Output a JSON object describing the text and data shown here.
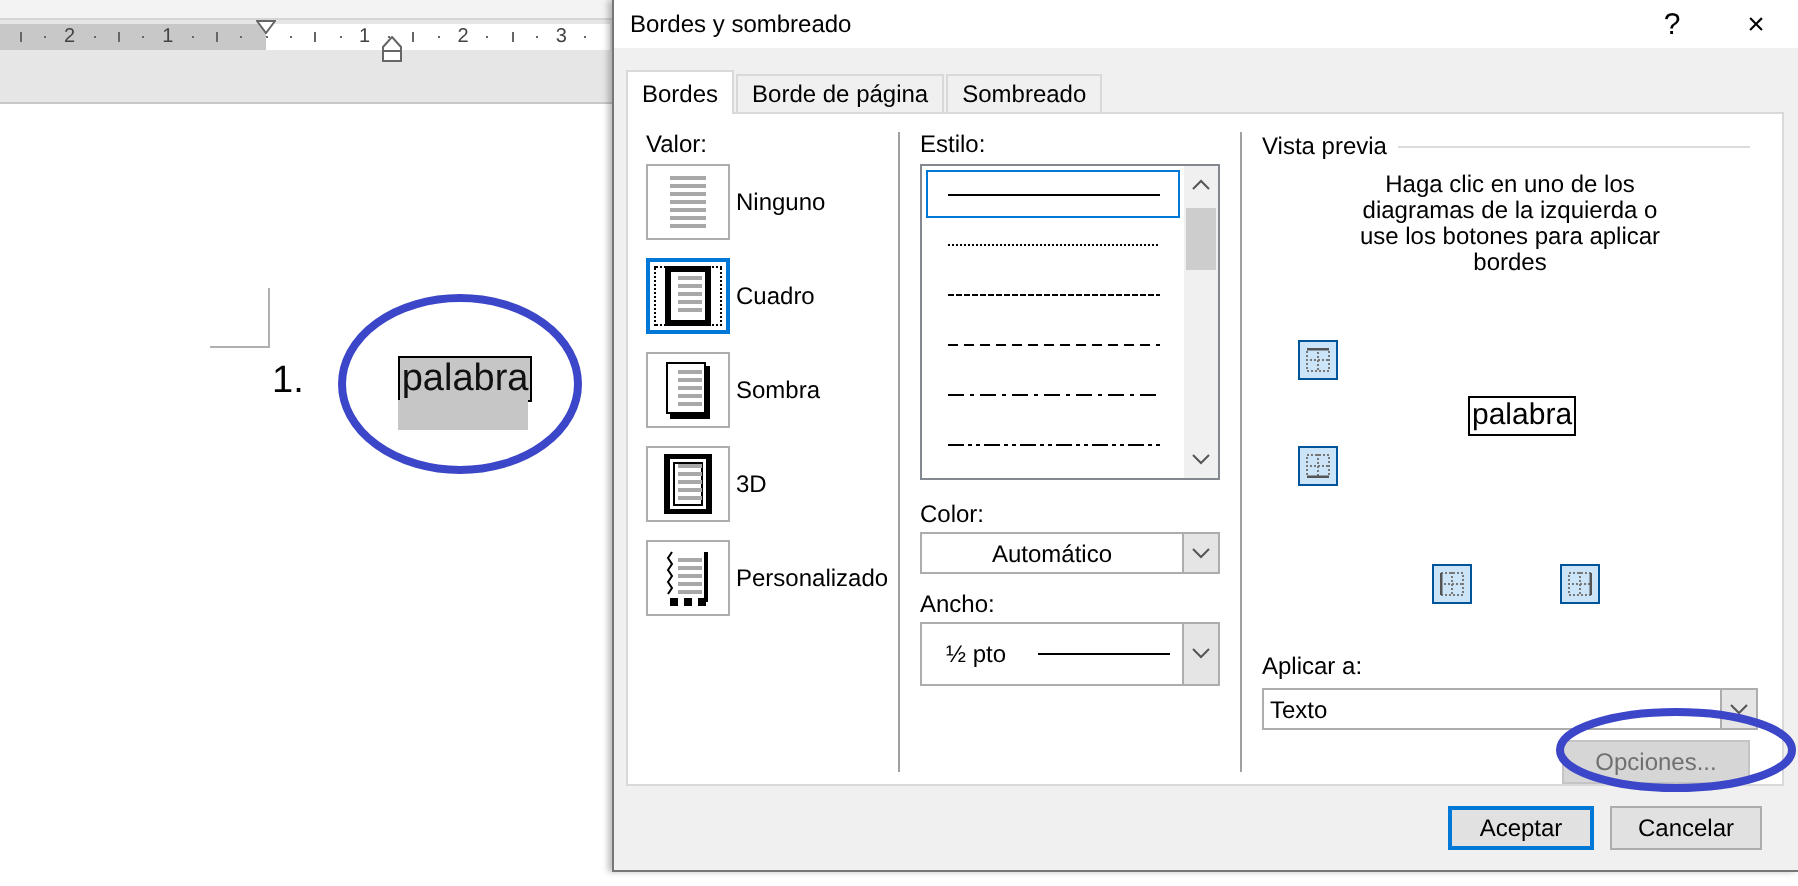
{
  "document": {
    "ruler_numbers": [
      "2",
      "1",
      "1",
      "2",
      "3"
    ],
    "list_number": "1.",
    "word": "palabra"
  },
  "dialog": {
    "title": "Bordes y sombreado",
    "help_button": "?",
    "close_button": "×",
    "tabs": [
      {
        "label": "Bordes",
        "selected": true
      },
      {
        "label": "Borde de página",
        "selected": false
      },
      {
        "label": "Sombreado",
        "selected": false
      }
    ],
    "setting": {
      "label": "Valor:",
      "items": [
        {
          "label": "Ninguno",
          "kind": "none",
          "selected": false
        },
        {
          "label": "Cuadro",
          "kind": "box",
          "selected": true
        },
        {
          "label": "Sombra",
          "kind": "shadow",
          "selected": false
        },
        {
          "label": "3D",
          "kind": "double",
          "selected": false
        },
        {
          "label": "Personalizado",
          "kind": "custom",
          "selected": false
        }
      ]
    },
    "style": {
      "label": "Estilo:",
      "options": [
        {
          "kind": "solid",
          "selected": true
        },
        {
          "kind": "dotted",
          "selected": false
        },
        {
          "kind": "short-dash",
          "selected": false
        },
        {
          "kind": "dash",
          "selected": false
        },
        {
          "kind": "dash-dot",
          "selected": false
        },
        {
          "kind": "dash-dot-dot",
          "selected": false
        }
      ]
    },
    "color": {
      "label": "Color:",
      "value": "Automático"
    },
    "width": {
      "label": "Ancho:",
      "value": "½ pto"
    },
    "preview": {
      "label": "Vista previa",
      "hint": "Haga clic en uno de los diagramas de la izquierda o use los botones para aplicar bordes",
      "sample": "palabra",
      "edge_buttons": [
        {
          "kind": "top",
          "on": true
        },
        {
          "kind": "bottom",
          "on": true
        },
        {
          "kind": "left",
          "on": true
        },
        {
          "kind": "right",
          "on": true
        }
      ]
    },
    "apply_to": {
      "label": "Aplicar a:",
      "value": "Texto"
    },
    "options_button": {
      "label": "Opciones...",
      "disabled": true
    },
    "buttons": [
      {
        "label": "Aceptar",
        "default": true
      },
      {
        "label": "Cancelar",
        "default": false
      }
    ]
  }
}
